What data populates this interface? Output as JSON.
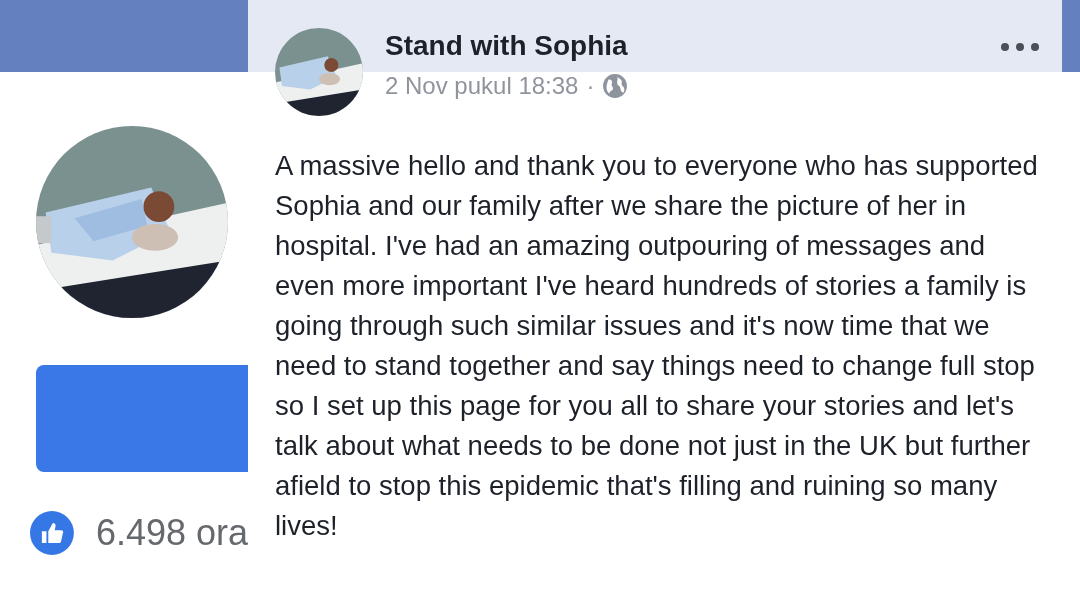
{
  "background_page": {
    "likes_count": "6.498 ora"
  },
  "post": {
    "page_name": "Stand with Sophia",
    "timestamp": "2 Nov pukul 18:38",
    "separator": "·",
    "body": "A massive hello and thank you to everyone who has supported Sophia and our family after we share the picture of her in hospital. I've had an amazing outpouring of messages and even more important I've heard hundreds of stories a family is going through such similar issues and it's now time that we need to stand together and say things need to change full stop so I set up this page for you all to share your stories and let's talk about what needs to be done not just in the UK but further afield to stop this epidemic that's filling and ruining so many lives!"
  }
}
